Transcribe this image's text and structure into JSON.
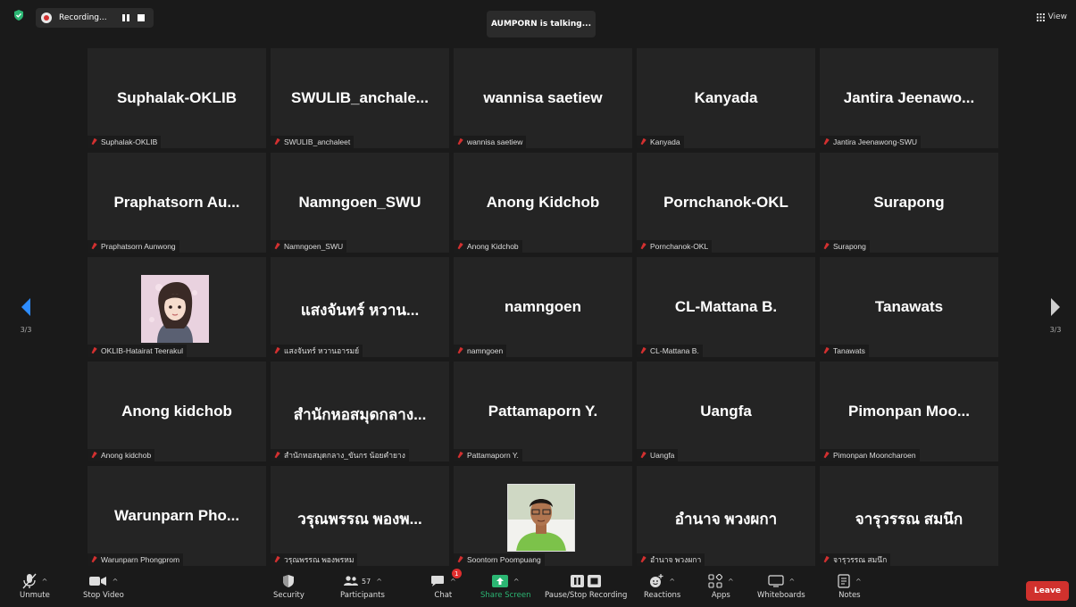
{
  "top": {
    "recording_label": "Recording...",
    "talking": "AUMPORN is talking...",
    "view_label": "View"
  },
  "nav": {
    "left_page": "3/3",
    "right_page": "3/3"
  },
  "tiles": [
    {
      "name": "Suphalak-OKLIB",
      "label": "Suphalak-OKLIB"
    },
    {
      "name": "SWULIB_anchale...",
      "label": "SWULIB_anchaleet"
    },
    {
      "name": "wannisa saetiew",
      "label": "wannisa saetiew"
    },
    {
      "name": "Kanyada",
      "label": "Kanyada"
    },
    {
      "name": "Jantira  Jeenawo...",
      "label": "Jantira Jeenawong-SWU"
    },
    {
      "name": "Praphatsorn  Au...",
      "label": "Praphatsorn Aunwong"
    },
    {
      "name": "Namngoen_SWU",
      "label": "Namngoen_SWU"
    },
    {
      "name": "Anong Kidchob",
      "label": "Anong Kidchob"
    },
    {
      "name": "Pornchanok-OKL",
      "label": "Pornchanok-OKL"
    },
    {
      "name": "Surapong",
      "label": "Surapong"
    },
    {
      "name": "",
      "label": "OKLIB-Hatairat Teerakul"
    },
    {
      "name": "แสงจันทร์ หวาน...",
      "label": "แสงจันทร์ หวานอารมย์"
    },
    {
      "name": "namngoen",
      "label": "namngoen"
    },
    {
      "name": "CL-Mattana B.",
      "label": "CL-Mattana B."
    },
    {
      "name": "Tanawats",
      "label": "Tanawats"
    },
    {
      "name": "Anong kidchob",
      "label": "Anong kidchob"
    },
    {
      "name": "สำนักหอสมุดกลาง...",
      "label": "สำนักหอสมุดกลาง_ขันกร น้อยคำยาง"
    },
    {
      "name": "Pattamaporn Y.",
      "label": "Pattamaporn Y."
    },
    {
      "name": "Uangfa",
      "label": "Uangfa"
    },
    {
      "name": "Pimonpan  Moo...",
      "label": "Pimonpan Mooncharoen"
    },
    {
      "name": "Warunparn  Pho...",
      "label": "Warunparn Phongprom"
    },
    {
      "name": "วรุณพรรณ พองพ...",
      "label": "วรุณพรรณ พองพรหม"
    },
    {
      "name": "",
      "label": "Soontorn Poompuang"
    },
    {
      "name": "อำนาจ พวงผกา",
      "label": "อำนาจ พวงผกา"
    },
    {
      "name": "จารุวรรณ สมนึก",
      "label": "จารุวรรณ สมนึก"
    }
  ],
  "toolbar": {
    "unmute": "Unmute",
    "stop_video": "Stop Video",
    "security": "Security",
    "participants": "Participants",
    "participants_count": "57",
    "chat": "Chat",
    "chat_badge": "1",
    "share_screen": "Share Screen",
    "pause_stop": "Pause/Stop Recording",
    "reactions": "Reactions",
    "apps": "Apps",
    "whiteboards": "Whiteboards",
    "notes": "Notes",
    "leave": "Leave"
  },
  "colors": {
    "share_green": "#2bb673",
    "leave_red": "#d0312d",
    "muted_red": "#d23030",
    "nav_blue": "#2d8cff"
  }
}
